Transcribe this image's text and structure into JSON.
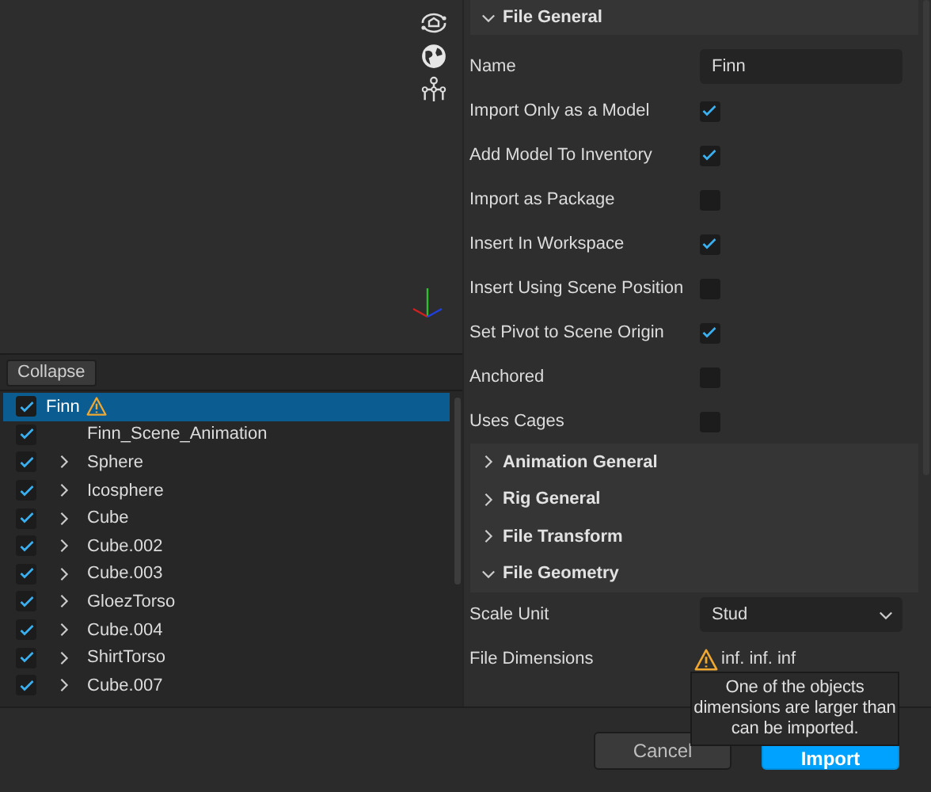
{
  "collapse_button": "Collapse",
  "tree": [
    {
      "label": "Finn",
      "checked": true,
      "selected": true,
      "warning": true,
      "expandable": false,
      "children": [
        {
          "label": "Finn_Scene_Animation",
          "checked": true,
          "selected": false,
          "expandable": false
        },
        {
          "label": "Sphere",
          "checked": true,
          "selected": false,
          "expandable": true
        },
        {
          "label": "Icosphere",
          "checked": true,
          "selected": false,
          "expandable": true
        },
        {
          "label": "Cube",
          "checked": true,
          "selected": false,
          "expandable": true
        },
        {
          "label": "Cube.002",
          "checked": true,
          "selected": false,
          "expandable": true
        },
        {
          "label": "Cube.003",
          "checked": true,
          "selected": false,
          "expandable": true
        },
        {
          "label": "GloezTorso",
          "checked": true,
          "selected": false,
          "expandable": true
        },
        {
          "label": "Cube.004",
          "checked": true,
          "selected": false,
          "expandable": true
        },
        {
          "label": "ShirtTorso",
          "checked": true,
          "selected": false,
          "expandable": true
        },
        {
          "label": "Cube.007",
          "checked": true,
          "selected": false,
          "expandable": true
        }
      ]
    }
  ],
  "sections": [
    {
      "title": "File General",
      "expanded": true,
      "rows": [
        {
          "kind": "text",
          "label": "Name",
          "value": "Finn"
        },
        {
          "kind": "checkbox",
          "label": "Import Only as a Model",
          "checked": true
        },
        {
          "kind": "checkbox",
          "label": "Add Model To Inventory",
          "checked": true
        },
        {
          "kind": "checkbox",
          "label": "Import as Package",
          "checked": false
        },
        {
          "kind": "checkbox",
          "label": "Insert In Workspace",
          "checked": true
        },
        {
          "kind": "checkbox",
          "label": "Insert Using Scene Position",
          "checked": false
        },
        {
          "kind": "checkbox",
          "label": "Set Pivot to Scene Origin",
          "checked": true
        },
        {
          "kind": "checkbox",
          "label": "Anchored",
          "checked": false
        },
        {
          "kind": "checkbox",
          "label": "Uses Cages",
          "checked": false
        }
      ]
    },
    {
      "title": "Animation General",
      "expanded": false
    },
    {
      "title": "Rig General",
      "expanded": false
    },
    {
      "title": "File Transform",
      "expanded": false
    },
    {
      "title": "File Geometry",
      "expanded": true,
      "rows": [
        {
          "kind": "dropdown",
          "label": "Scale Unit",
          "value": "Stud"
        },
        {
          "kind": "readout",
          "label": "File Dimensions",
          "value": "inf. inf. inf",
          "warning": true
        }
      ]
    }
  ],
  "tooltip": "One of the objects dimensions are larger than can be imported.",
  "buttons": [
    {
      "label": "Cancel",
      "kind": "secondary"
    },
    {
      "label": "Import",
      "kind": "primary"
    }
  ]
}
